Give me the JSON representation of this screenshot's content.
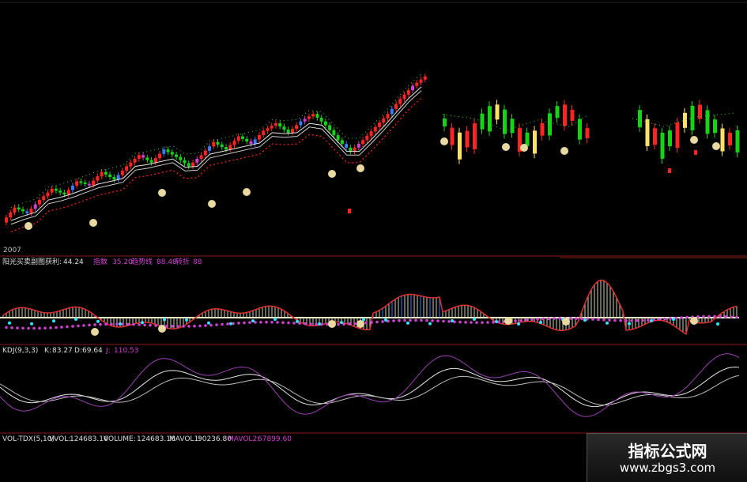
{
  "colors": {
    "up": "#ff2424",
    "down": "#14d414",
    "magenta": "#d040d0",
    "blue": "#3a7bff",
    "cyan": "#33e0ff",
    "white": "#e6e6e6",
    "yellow": "#ffe066",
    "divider": "#8b1a1a",
    "grid": "#5a1010"
  },
  "main_panel": {
    "header_marks": "",
    "footer_label": "2007"
  },
  "indicator_panel": {
    "name": "阳光买卖副图",
    "v1_label": "获利:",
    "v1": "44.24",
    "v2_label": "指数",
    "v2": "35.20",
    "v3_label": "趋势线",
    "v3": "88.48",
    "v4_label": "转折",
    "v4": "88"
  },
  "kdj_panel": {
    "name": "KDJ(9,3,3)",
    "k_label": "K:",
    "k": "83.27",
    "d_label": "D:",
    "d": "69.64",
    "j_label": "J:",
    "j": "110.53"
  },
  "vol_panel": {
    "name": "VOL-TDX(5,10)",
    "vvol_label": "VVOL:",
    "vvol": "124683.16",
    "volume_label": "VOLUME:",
    "volume": "124683.16",
    "mavol1_label": "MAVOL1:",
    "mavol1": "90236.80",
    "mavol2_label": "MAVOL2:",
    "mavol2": "67899.60"
  },
  "watermark": {
    "title": "指标公式网",
    "url": "www.zbgs3.com"
  },
  "chart_data": {
    "type": "candlestick",
    "candles": [
      [
        0.22,
        0.3,
        0.18,
        0.33
      ],
      [
        0.3,
        0.27,
        0.25,
        0.34
      ],
      [
        0.27,
        0.34,
        0.25,
        0.36
      ],
      [
        0.34,
        0.4,
        0.31,
        0.42
      ],
      [
        0.4,
        0.37,
        0.35,
        0.43
      ],
      [
        0.37,
        0.44,
        0.36,
        0.46
      ],
      [
        0.44,
        0.42,
        0.4,
        0.47
      ],
      [
        0.42,
        0.49,
        0.41,
        0.51
      ],
      [
        0.49,
        0.45,
        0.43,
        0.52
      ],
      [
        0.45,
        0.52,
        0.44,
        0.55
      ],
      [
        0.52,
        0.58,
        0.5,
        0.6
      ],
      [
        0.58,
        0.54,
        0.52,
        0.61
      ],
      [
        0.54,
        0.61,
        0.53,
        0.63
      ],
      [
        0.61,
        0.57,
        0.55,
        0.64
      ],
      [
        0.57,
        0.52,
        0.5,
        0.59
      ],
      [
        0.52,
        0.58,
        0.51,
        0.61
      ],
      [
        0.58,
        0.65,
        0.56,
        0.67
      ],
      [
        0.65,
        0.61,
        0.59,
        0.68
      ],
      [
        0.61,
        0.68,
        0.6,
        0.7
      ],
      [
        0.68,
        0.64,
        0.62,
        0.71
      ],
      [
        0.64,
        0.71,
        0.63,
        0.73
      ],
      [
        0.71,
        0.75,
        0.69,
        0.77
      ],
      [
        0.75,
        0.7,
        0.68,
        0.78
      ],
      [
        0.7,
        0.76,
        0.69,
        0.79
      ],
      [
        0.76,
        0.8,
        0.74,
        0.83
      ],
      [
        0.8,
        0.74,
        0.72,
        0.82
      ],
      [
        0.74,
        0.66,
        0.64,
        0.76
      ],
      [
        0.66,
        0.6,
        0.58,
        0.68
      ],
      [
        0.6,
        0.66,
        0.58,
        0.69
      ],
      [
        0.66,
        0.73,
        0.65,
        0.75
      ],
      [
        0.73,
        0.8,
        0.72,
        0.82
      ],
      [
        0.8,
        0.88,
        0.78,
        0.92
      ],
      [
        0.88,
        0.95,
        0.86,
        0.99
      ],
      [
        0.95,
        1.0,
        0.93,
        1.03
      ]
    ],
    "ylim": [
      0.1,
      1.05
    ]
  }
}
